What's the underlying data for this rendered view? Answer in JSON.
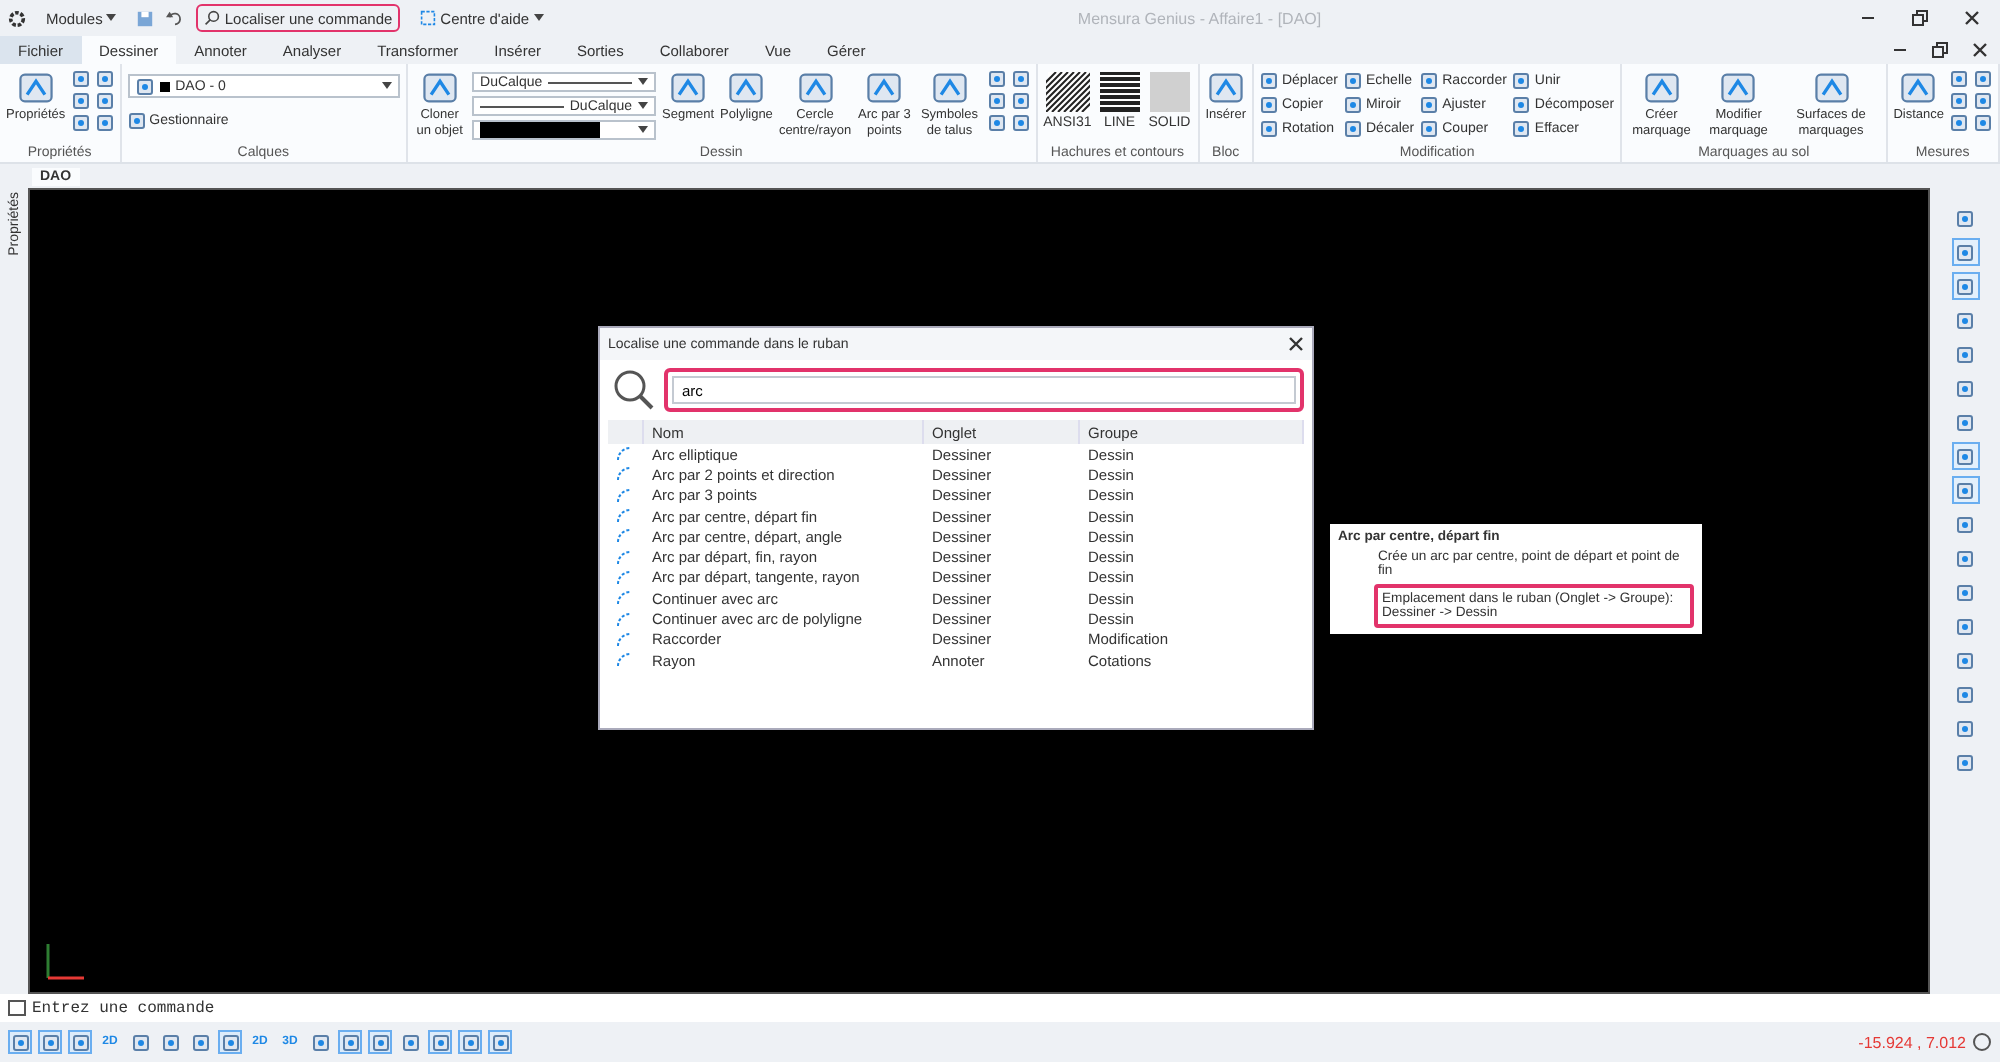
{
  "title_bar": {
    "modules": "Modules",
    "search_button": {
      "label": "Localiser une commande",
      "highlighted": true
    },
    "help": "Centre d'aide",
    "title": "Mensura Genius - Affaire1 - [DAO]"
  },
  "tabs": [
    {
      "label": "Fichier",
      "selected": false,
      "kind": "file"
    },
    {
      "label": "Dessiner",
      "selected": true,
      "kind": "tab"
    },
    {
      "label": "Annoter",
      "selected": false,
      "kind": "tab"
    },
    {
      "label": "Analyser",
      "selected": false,
      "kind": "tab"
    },
    {
      "label": "Transformer",
      "selected": false,
      "kind": "tab"
    },
    {
      "label": "Insérer",
      "selected": false,
      "kind": "tab"
    },
    {
      "label": "Sorties",
      "selected": false,
      "kind": "tab"
    },
    {
      "label": "Collaborer",
      "selected": false,
      "kind": "tab"
    },
    {
      "label": "Vue",
      "selected": false,
      "kind": "tab"
    },
    {
      "label": "Gérer",
      "selected": false,
      "kind": "tab"
    }
  ],
  "ribbon": [
    {
      "title": "Propriétés",
      "items": [
        {
          "kind": "large",
          "label": "Propriétés"
        },
        {
          "kind": "icons"
        }
      ]
    },
    {
      "title": "Calques",
      "items": [
        {
          "kind": "layer",
          "value": "DAO - 0",
          "manager": "Gestionnaire"
        }
      ]
    },
    {
      "title": "Dessin",
      "items": [
        {
          "kind": "large",
          "label": "Cloner un objet"
        },
        {
          "kind": "style",
          "values": [
            "DuCalque",
            "DuCalque"
          ]
        },
        {
          "kind": "large",
          "label": "Segment"
        },
        {
          "kind": "large",
          "label": "Polyligne"
        },
        {
          "kind": "large",
          "label": "Cercle centre/rayon"
        },
        {
          "kind": "large",
          "label": "Arc par 3 points"
        },
        {
          "kind": "large",
          "label": "Symboles de talus"
        },
        {
          "kind": "icons"
        }
      ]
    },
    {
      "title": "Hachures et contours",
      "items": [
        {
          "kind": "hatch",
          "label": "ANSI31"
        },
        {
          "kind": "lines",
          "label": "LINE"
        },
        {
          "kind": "solid",
          "label": "SOLID"
        }
      ]
    },
    {
      "title": "Bloc",
      "items": [
        {
          "kind": "large",
          "label": "Insérer"
        }
      ]
    },
    {
      "title": "Modification",
      "items": [
        {
          "kind": "stack",
          "rows": [
            "Déplacer",
            "Copier",
            "Rotation"
          ]
        },
        {
          "kind": "stack",
          "rows": [
            "Echelle",
            "Miroir",
            "Décaler"
          ]
        },
        {
          "kind": "stack",
          "rows": [
            "Raccorder",
            "Ajuster",
            "Couper"
          ]
        },
        {
          "kind": "stack",
          "rows": [
            "Unir",
            "Décomposer",
            "Effacer"
          ]
        }
      ]
    },
    {
      "title": "Marquages au sol",
      "items": [
        {
          "kind": "large",
          "label": "Créer marquage"
        },
        {
          "kind": "large",
          "label": "Modifier marquage"
        },
        {
          "kind": "large",
          "label": "Surfaces de marquages"
        }
      ]
    },
    {
      "title": "Mesures",
      "items": [
        {
          "kind": "large",
          "label": "Distance"
        },
        {
          "kind": "icons"
        }
      ]
    }
  ],
  "document_tab": "DAO",
  "side_panel": "Propriétés",
  "right_toolbar": [
    {
      "selected": false
    },
    {
      "selected": true
    },
    {
      "selected": true
    },
    {
      "selected": false
    },
    {
      "selected": false
    },
    {
      "selected": false
    },
    {
      "selected": false
    },
    {
      "selected": true
    },
    {
      "selected": true
    },
    {
      "selected": false
    },
    {
      "selected": false
    },
    {
      "selected": false
    },
    {
      "selected": false
    },
    {
      "selected": false
    },
    {
      "selected": false
    },
    {
      "selected": false
    },
    {
      "selected": false
    }
  ],
  "dialog": {
    "title": "Localise une commande dans le ruban",
    "search": {
      "value": "arc",
      "highlighted": true
    },
    "columns": [
      "Nom",
      "Onglet",
      "Groupe"
    ],
    "rows": [
      {
        "name": "Arc elliptique",
        "tab": "Dessiner",
        "group": "Dessin"
      },
      {
        "name": "Arc par 2 points et direction",
        "tab": "Dessiner",
        "group": "Dessin"
      },
      {
        "name": "Arc par 3 points",
        "tab": "Dessiner",
        "group": "Dessin"
      },
      {
        "name": "Arc par centre, départ fin",
        "tab": "Dessiner",
        "group": "Dessin"
      },
      {
        "name": "Arc par centre, départ, angle",
        "tab": "Dessiner",
        "group": "Dessin"
      },
      {
        "name": "Arc par départ, fin, rayon",
        "tab": "Dessiner",
        "group": "Dessin"
      },
      {
        "name": "Arc par départ, tangente, rayon",
        "tab": "Dessiner",
        "group": "Dessin"
      },
      {
        "name": "Continuer avec arc",
        "tab": "Dessiner",
        "group": "Dessin"
      },
      {
        "name": "Continuer avec arc de polyligne",
        "tab": "Dessiner",
        "group": "Dessin"
      },
      {
        "name": "Raccorder",
        "tab": "Dessiner",
        "group": "Modification"
      },
      {
        "name": "Rayon",
        "tab": "Annoter",
        "group": "Cotations"
      }
    ]
  },
  "tooltip": {
    "title": "Arc par centre, départ fin",
    "description": "Crée un arc par centre, point de départ et point de fin",
    "location": "Emplacement dans le ruban (Onglet -> Groupe):",
    "path": "Dessiner -> Dessin",
    "highlighted": true
  },
  "command_line": {
    "placeholder": "Entrez une commande"
  },
  "status_bar": {
    "buttons": [
      {
        "selected": true
      },
      {
        "selected": true
      },
      {
        "selected": true
      },
      {
        "selected": false,
        "label": "2D"
      },
      {
        "selected": false
      },
      {
        "selected": false
      },
      {
        "selected": false
      },
      {
        "selected": true
      },
      {
        "selected": false,
        "label": "2D"
      },
      {
        "selected": false,
        "label": "3D"
      },
      {
        "selected": false
      },
      {
        "selected": true
      },
      {
        "selected": true
      },
      {
        "selected": false
      },
      {
        "selected": true
      },
      {
        "selected": true
      },
      {
        "selected": true
      }
    ],
    "coordinates": "-15.924 , 7.012"
  }
}
